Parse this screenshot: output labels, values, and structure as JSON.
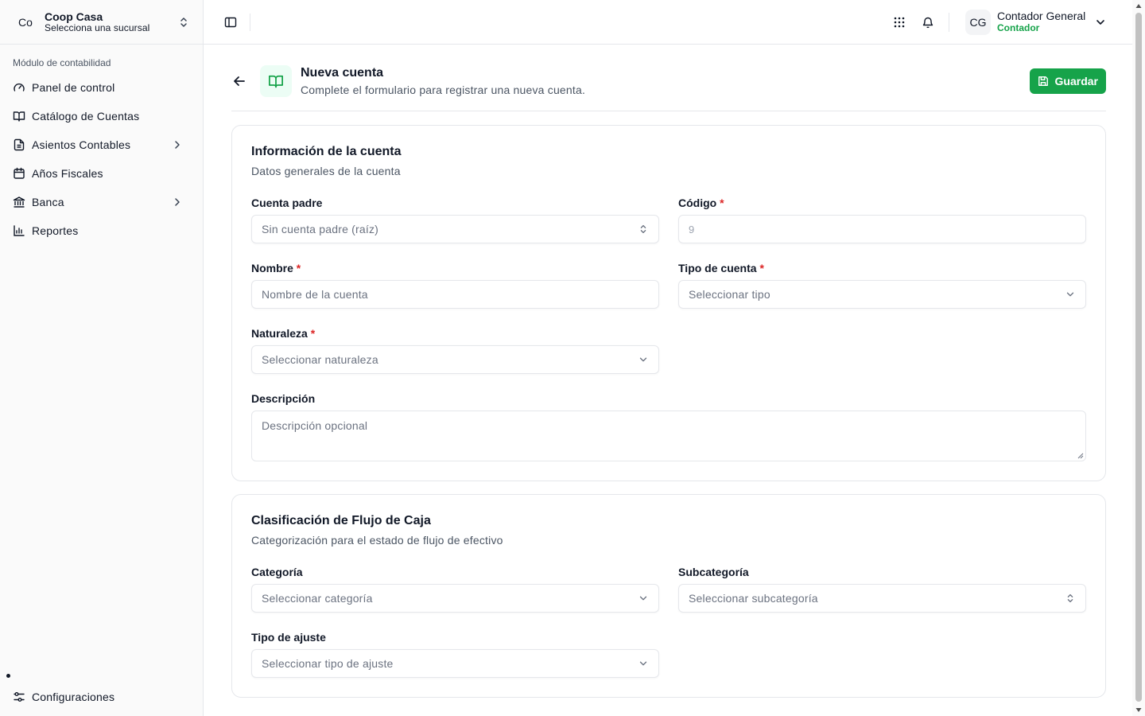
{
  "sidebar": {
    "org_avatar": "Co",
    "org_name": "Coop Casa",
    "org_sub": "Selecciona una sucursal",
    "section_label": "Módulo de contabilidad",
    "items": [
      {
        "label": "Panel de control",
        "icon": "gauge-icon"
      },
      {
        "label": "Catálogo de Cuentas",
        "icon": "book-open-icon"
      },
      {
        "label": "Asientos Contables",
        "icon": "file-text-icon"
      },
      {
        "label": "Años Fiscales",
        "icon": "calendar-icon"
      },
      {
        "label": "Banca",
        "icon": "bank-icon"
      },
      {
        "label": "Reportes",
        "icon": "bar-chart-icon"
      }
    ],
    "settings_label": "Configuraciones"
  },
  "header": {
    "user_avatar": "CG",
    "user_name": "Contador General",
    "user_role": "Contador"
  },
  "page": {
    "title": "Nueva cuenta",
    "subtitle": "Complete el formulario para registrar una nueva cuenta.",
    "save_label": "Guardar"
  },
  "account_info": {
    "title": "Información de la cuenta",
    "subtitle": "Datos generales de la cuenta",
    "parent_label": "Cuenta padre",
    "parent_value": "Sin cuenta padre (raíz)",
    "code_label": "Código",
    "code_value": "9",
    "name_label": "Nombre",
    "name_placeholder": "Nombre de la cuenta",
    "type_label": "Tipo de cuenta",
    "type_placeholder": "Seleccionar tipo",
    "nature_label": "Naturaleza",
    "nature_placeholder": "Seleccionar naturaleza",
    "desc_label": "Descripción",
    "desc_placeholder": "Descripción opcional",
    "required_mark": "*"
  },
  "cash_flow": {
    "title": "Clasificación de Flujo de Caja",
    "subtitle": "Categorización para el estado de flujo de efectivo",
    "category_label": "Categoría",
    "category_placeholder": "Seleccionar categoría",
    "subcategory_label": "Subcategoría",
    "subcategory_placeholder": "Seleccionar subcategoría",
    "adjust_label": "Tipo de ajuste",
    "adjust_placeholder": "Seleccionar tipo de ajuste"
  },
  "colors": {
    "accent": "#16a34a",
    "required": "#dc2626",
    "border": "#e5e7eb"
  }
}
